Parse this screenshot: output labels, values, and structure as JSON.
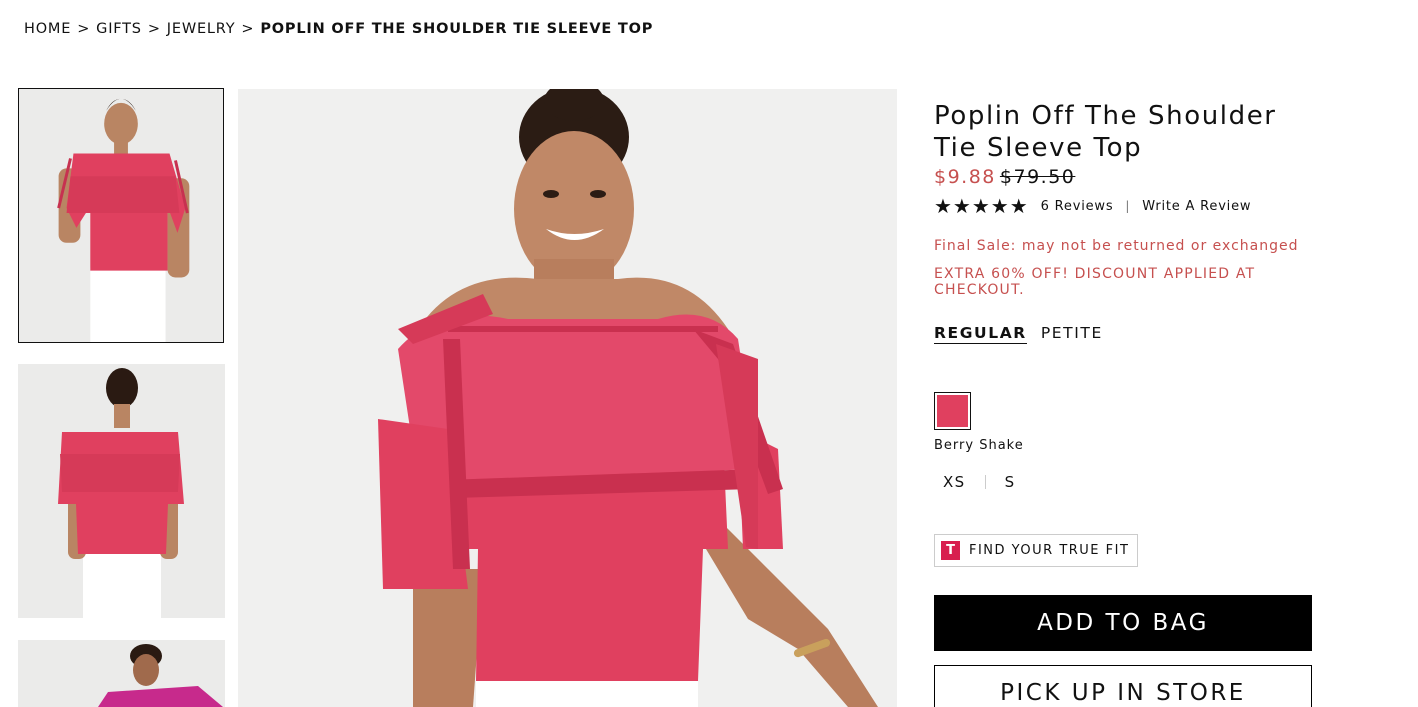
{
  "breadcrumb": {
    "items": [
      "HOME",
      "GIFTS",
      "JEWELRY"
    ],
    "separator": ">",
    "current": "POPLIN OFF THE SHOULDER TIE SLEEVE TOP"
  },
  "product": {
    "title": "Poplin Off The Shoulder Tie Sleeve Top",
    "price_sale": "$9.88",
    "price_original": "$79.50",
    "rating_stars": "★★★★★",
    "rating_value": 5,
    "reviews_label": "6 Reviews",
    "rating_divider": "|",
    "write_review_label": "Write A Review",
    "final_sale_text": "Final Sale: may not be returned or exchanged",
    "promo_text": "EXTRA 60% OFF! DISCOUNT APPLIED AT CHECKOUT.",
    "size_types": [
      "REGULAR",
      "PETITE"
    ],
    "selected_size_type": "REGULAR",
    "color_name": "Berry Shake",
    "sizes": [
      "XS",
      "S"
    ],
    "true_fit_icon_letter": "T",
    "true_fit_label": "FIND YOUR TRUE FIT",
    "add_to_bag_label": "ADD TO BAG",
    "pickup_label": "PICK UP IN STORE"
  },
  "colors": {
    "sale_red": "#c6504f",
    "swatch_berry": "#e0405f",
    "true_fit_brand": "#d81e4f",
    "button_black": "#000000",
    "image_background": "#ebebea"
  },
  "icons": {
    "thumbnail_1": "product-front-image",
    "thumbnail_2": "product-back-image",
    "thumbnail_3": "product-alt-image",
    "true_fit_logo": "true-fit-logo-icon"
  }
}
